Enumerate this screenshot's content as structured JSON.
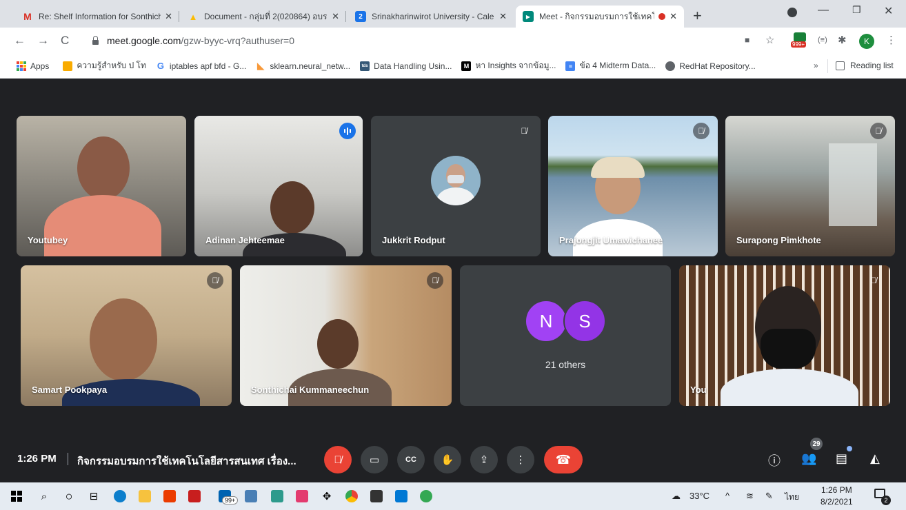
{
  "browser": {
    "tabs": [
      {
        "title": "Re: Shelf Information for Sonthich",
        "icon": "gmail-icon",
        "color": "#d93025",
        "glyph": "M",
        "active": false
      },
      {
        "title": "Document - กลุ่มที่ 2(020864) อบร",
        "icon": "drive-icon",
        "color": "#1a73e8",
        "glyph": "▲",
        "active": false
      },
      {
        "title": "Srinakharinwirot University - Cale",
        "icon": "calendar-icon",
        "color": "#1a73e8",
        "glyph": "2",
        "active": false
      },
      {
        "title": "Meet - กิจกรรมอบรมการใช้เทคโ",
        "icon": "meet-icon",
        "color": "#00897b",
        "glyph": "▶",
        "active": true
      }
    ],
    "url_host": "meet.google.com",
    "url_path": "/gzw-byyc-vrq?authuser=0",
    "extension_badge": "999+",
    "profile_initial": "K",
    "bookmarks": [
      {
        "label": "Apps",
        "icon": "apps-grid-icon"
      },
      {
        "label": "ความรู้สำหรับ ป โท",
        "icon": "folder-icon",
        "color": "#f9ab00",
        "glyph": ""
      },
      {
        "label": "iptables apf bfd - G...",
        "icon": "google-icon",
        "color": "#4285f4",
        "glyph": "G"
      },
      {
        "label": "sklearn.neural_netw...",
        "icon": "sklearn-icon",
        "color": "#f89939",
        "glyph": "◣"
      },
      {
        "label": "Data Handling Usin...",
        "icon": "tds-icon",
        "color": "#355876",
        "glyph": "tds"
      },
      {
        "label": "หา Insights จากข้อมู...",
        "icon": "medium-icon",
        "color": "#000000",
        "glyph": "M"
      },
      {
        "label": "ข้อ 4 Midterm Data...",
        "icon": "forms-icon",
        "color": "#4285f4",
        "glyph": "≡"
      },
      {
        "label": "RedHat Repository...",
        "icon": "globe-icon",
        "color": "#5f6368",
        "glyph": "◉"
      }
    ],
    "more_bookmarks": "»",
    "reading_list": "Reading list"
  },
  "meet": {
    "participants_row1": [
      {
        "name": "Youtubey",
        "muted": false,
        "speaking": false
      },
      {
        "name": "Adinan Jehteemae",
        "muted": false,
        "speaking": true
      },
      {
        "name": "Jukkrit Rodput",
        "muted": true,
        "speaking": false
      },
      {
        "name": "Prajongjit Umawichanee",
        "muted": true,
        "speaking": false
      },
      {
        "name": "Surapong Pimkhote",
        "muted": true,
        "speaking": false
      }
    ],
    "participants_row2": [
      {
        "name": "Samart Pookpaya",
        "muted": true
      },
      {
        "name": "Sonthichai Kummaneechun",
        "muted": true
      },
      {
        "name": "You",
        "muted": true
      }
    ],
    "others": {
      "initials": [
        "N",
        "S"
      ],
      "colors": [
        "#a142f4",
        "#9334e6"
      ],
      "label": "21 others"
    },
    "time": "1:26 PM",
    "meeting_title": "กิจกรรมอบรมการใช้เทคโนโลยีสารสนเทศ เรื่อง...",
    "participant_count": "29"
  },
  "taskbar": {
    "temperature": "33°C",
    "language": "ไทย",
    "time": "1:26 PM",
    "date": "8/2/2021",
    "mail_badge": "99+",
    "notification_count": "2"
  },
  "colors": {
    "meet_bg": "#202124",
    "tile_bg": "#3c4043",
    "danger": "#ea4335",
    "speaking": "#1a73e8"
  }
}
